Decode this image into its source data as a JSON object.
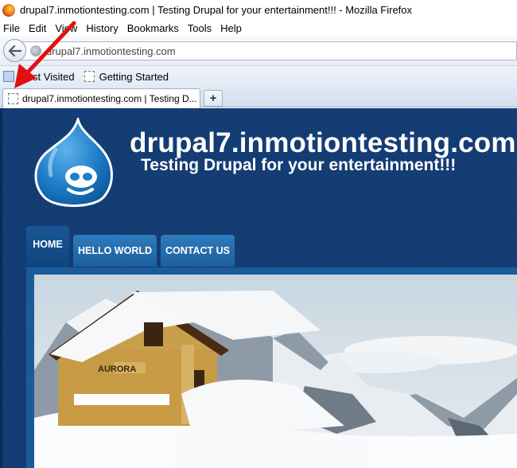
{
  "window": {
    "title": "drupal7.inmotiontesting.com | Testing Drupal for your entertainment!!! - Mozilla Firefox"
  },
  "menu": [
    "File",
    "Edit",
    "View",
    "History",
    "Bookmarks",
    "Tools",
    "Help"
  ],
  "nav": {
    "url": "drupal7.inmotiontesting.com"
  },
  "bookmarks": {
    "most_visited": "Most Visited",
    "getting_started": "Getting Started"
  },
  "tabs": {
    "active_label": "drupal7.inmotiontesting.com | Testing D...",
    "new_tab": "+"
  },
  "site": {
    "name": "drupal7.inmotiontesting.com",
    "slogan": "Testing Drupal for your entertainment!!!",
    "nav": [
      "HOME",
      "HELLO WORLD",
      "CONTACT US"
    ],
    "hero_sign": "AURORA"
  },
  "colors": {
    "page_bg": "#163f78",
    "nav_tab": "#2f7bbd",
    "arrow": "#e01010"
  }
}
